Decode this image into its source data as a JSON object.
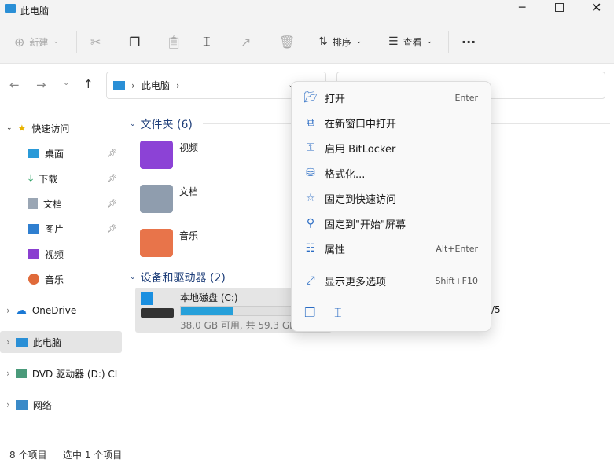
{
  "window": {
    "title": "此电脑"
  },
  "toolbar": {
    "new_label": "新建",
    "sort_label": "排序",
    "view_label": "查看",
    "more": "···"
  },
  "address": {
    "crumb": "此电脑"
  },
  "sidebar": {
    "quick_access": "快速访问",
    "items": [
      {
        "label": "桌面",
        "pinned": true
      },
      {
        "label": "下载",
        "pinned": true
      },
      {
        "label": "文档",
        "pinned": true
      },
      {
        "label": "图片",
        "pinned": true
      },
      {
        "label": "视频",
        "pinned": false
      },
      {
        "label": "音乐",
        "pinned": false
      }
    ],
    "onedrive": "OneDrive",
    "this_pc": "此电脑",
    "dvd": "DVD 驱动器 (D:) CI",
    "network": "网络"
  },
  "main": {
    "folders_header": "文件夹 (6)",
    "folders": [
      "视频",
      "文档",
      "音乐"
    ],
    "devices_header": "设备和驱动器 (2)",
    "drive": {
      "name": "本地磁盘 (C:)",
      "info": "38.0 GB 可用, 共 59.3 GB",
      "used_percent": 36,
      "bar_color": "#26a0da"
    },
    "drive2_fragment": "/5"
  },
  "context_menu": {
    "items": [
      {
        "icon": "folder-open-icon",
        "label": "打开",
        "shortcut": "Enter"
      },
      {
        "icon": "open-new-window-icon",
        "label": "在新窗口中打开",
        "shortcut": ""
      },
      {
        "icon": "bitlocker-key-icon",
        "label": "启用 BitLocker",
        "shortcut": ""
      },
      {
        "icon": "format-icon",
        "label": "格式化...",
        "shortcut": ""
      },
      {
        "icon": "star-icon",
        "label": "固定到快速访问",
        "shortcut": ""
      },
      {
        "icon": "pin-icon",
        "label": "固定到\"开始\"屏幕",
        "shortcut": ""
      },
      {
        "icon": "properties-icon",
        "label": "属性",
        "shortcut": "Alt+Enter"
      },
      {
        "icon": "show-more-icon",
        "label": "显示更多选项",
        "shortcut": "Shift+F10"
      }
    ]
  },
  "status": {
    "count": "8 个项目",
    "selected": "选中 1 个项目"
  }
}
